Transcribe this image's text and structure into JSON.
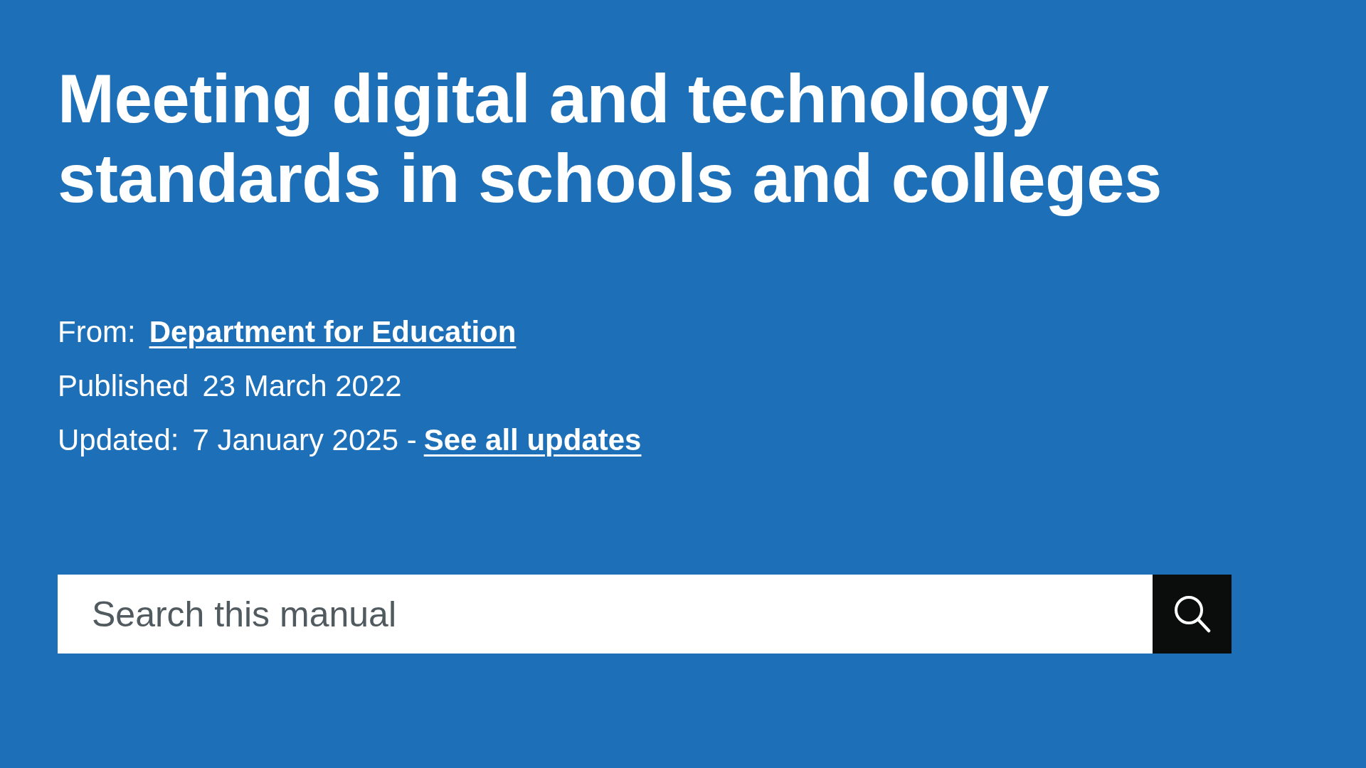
{
  "title": "Meeting digital and technology standards in schools and colleges",
  "metadata": [
    {
      "label": "From:",
      "parts": [
        {
          "kind": "link",
          "text": "Department for Education"
        }
      ]
    },
    {
      "label": "Published",
      "parts": [
        {
          "kind": "text",
          "text": "23 March 2022"
        }
      ]
    },
    {
      "label": "Updated:",
      "parts": [
        {
          "kind": "text",
          "text": "7 January 2025 -"
        },
        {
          "kind": "link",
          "text": "See all updates"
        }
      ]
    }
  ],
  "search": {
    "placeholder": "Search this manual"
  }
}
